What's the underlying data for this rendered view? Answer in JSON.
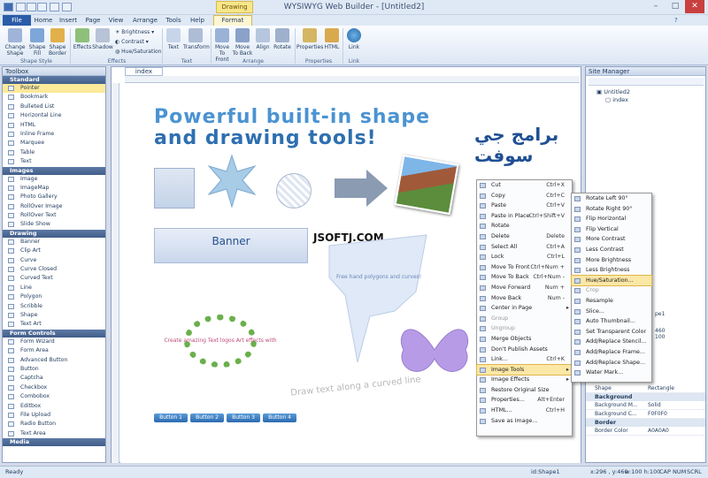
{
  "app": {
    "title": "WYSIWYG Web Builder - [Untitled2]",
    "context_tab": "Drawing Tools"
  },
  "menu": {
    "file": "File",
    "home": "Home",
    "insert": "Insert",
    "page": "Page",
    "view": "View",
    "arrange": "Arrange",
    "tools": "Tools",
    "help": "Help",
    "format": "Format"
  },
  "ribbon": {
    "change_shape": "Change Shape",
    "shape_fill": "Shape Fill",
    "shape_border": "Shape Border",
    "effects": "Effects",
    "shadow": "Shadow",
    "brightness": "Brightness",
    "contrast": "Contrast",
    "hue_saturation": "Hue/Saturation",
    "text": "Text",
    "transform": "Transform",
    "move_to_front": "Move To Front",
    "move_to_back": "Move To Back",
    "align": "Align",
    "rotate": "Rotate",
    "properties": "Properties",
    "html": "HTML",
    "link": "Link",
    "groups": {
      "shape_style": "Shape Style",
      "effects": "Effects",
      "text": "Text",
      "arrange": "Arrange",
      "properties": "Properties",
      "link": "Link"
    }
  },
  "toolbox": {
    "title": "Toolbox",
    "categories": [
      {
        "name": "Standard",
        "items": [
          "Pointer",
          "Bookmark",
          "Bulleted List",
          "Horizontal Line",
          "HTML",
          "Inline Frame",
          "Marquee",
          "Table",
          "Text"
        ]
      },
      {
        "name": "Images",
        "items": [
          "Image",
          "ImageMap",
          "Photo Gallery",
          "RollOver Image",
          "RollOver Text",
          "Slide Show"
        ]
      },
      {
        "name": "Drawing",
        "items": [
          "Banner",
          "Clip Art",
          "Curve",
          "Curve Closed",
          "Curved Text",
          "Line",
          "Polygon",
          "Scribble",
          "Shape",
          "Text Art"
        ]
      },
      {
        "name": "Form Controls",
        "items": [
          "Form Wizard",
          "Form Area",
          "Advanced Button",
          "Button",
          "Captcha",
          "Checkbox",
          "Combobox",
          "Editbox",
          "File Upload",
          "Radio Button",
          "Text Area"
        ]
      },
      {
        "name": "Media",
        "items": []
      }
    ]
  },
  "editor": {
    "tab": "index",
    "headline1": "Powerful built-in shape",
    "headline2": "and drawing tools!",
    "arabic": "برامج جي سوفت",
    "banner": "Banner",
    "watermark": "JSOFTJ.COM",
    "freehand": "Free hand polygons and curves!",
    "circle_text": "Create amazing Text logos Art effects with",
    "curve_text": "Draw text along a curved line",
    "buttons": [
      "Button 1",
      "Button 2",
      "Button 3",
      "Button 4"
    ]
  },
  "context_menu": [
    {
      "label": "Cut",
      "shortcut": "Ctrl+X"
    },
    {
      "label": "Copy",
      "shortcut": "Ctrl+C"
    },
    {
      "label": "Paste",
      "shortcut": "Ctrl+V"
    },
    {
      "label": "Paste in Place",
      "shortcut": "Ctrl+Shift+V"
    },
    {
      "label": "Rotate",
      "shortcut": ""
    },
    {
      "label": "Delete",
      "shortcut": "Delete"
    },
    {
      "label": "Select All",
      "shortcut": "Ctrl+A"
    },
    {
      "label": "Lock",
      "shortcut": "Ctrl+L"
    },
    {
      "label": "Move To Front",
      "shortcut": "Ctrl+Num +"
    },
    {
      "label": "Move To Back",
      "shortcut": "Ctrl+Num -"
    },
    {
      "label": "Move Forward",
      "shortcut": "Num +"
    },
    {
      "label": "Move Back",
      "shortcut": "Num -"
    },
    {
      "label": "Center in Page",
      "shortcut": ""
    },
    {
      "label": "Group",
      "shortcut": ""
    },
    {
      "label": "Ungroup",
      "shortcut": ""
    },
    {
      "label": "Merge Objects",
      "shortcut": ""
    },
    {
      "label": "Don't Publish Assets",
      "shortcut": ""
    },
    {
      "label": "Link...",
      "shortcut": "Ctrl+K"
    },
    {
      "label": "Image Tools",
      "shortcut": ""
    },
    {
      "label": "Image Effects",
      "shortcut": ""
    },
    {
      "label": "Restore Original Size",
      "shortcut": ""
    },
    {
      "label": "Properties...",
      "shortcut": "Alt+Enter"
    },
    {
      "label": "HTML...",
      "shortcut": "Ctrl+H"
    },
    {
      "label": "Save as Image...",
      "shortcut": ""
    }
  ],
  "submenu": [
    "Rotate Left 90°",
    "Rotate Right 90°",
    "Flip Horizontal",
    "Flip Vertical",
    "More Contrast",
    "Less Contrast",
    "More Brightness",
    "Less Brightness",
    "Hue/Saturation...",
    "Crop",
    "Resample",
    "Slice...",
    "Auto Thumbnail...",
    "Set Transparent Color",
    "Add/Replace Stencil...",
    "Add/Replace Frame...",
    "Add/Replace Shape...",
    "Water Mark..."
  ],
  "site_manager": {
    "title": "Site Manager",
    "root": "Untitled2",
    "page": "index"
  },
  "properties": {
    "partial": [
      "pe1",
      "460",
      "100"
    ],
    "shape_row": {
      "key": "Shape",
      "value": "Rectangle"
    },
    "background_cat": "Background",
    "bg_mode": {
      "key": "Background M...",
      "value": "Solid"
    },
    "bg_color": {
      "key": "Background C...",
      "value": "F0F0F0"
    },
    "border_cat": "Border",
    "border_color": {
      "key": "Border Color",
      "value": "A0A0A0"
    }
  },
  "status": {
    "ready": "Ready",
    "id": "id:Shape1",
    "coords": "x:296 , y:460",
    "size": "w:100 h:100",
    "cap": "CAP",
    "num": "NUM",
    "scrl": "SCRL"
  },
  "colors": {
    "accent": "#2a5ca8",
    "highlight": "#fbe7a6",
    "title_blue": "#3d86c6"
  }
}
